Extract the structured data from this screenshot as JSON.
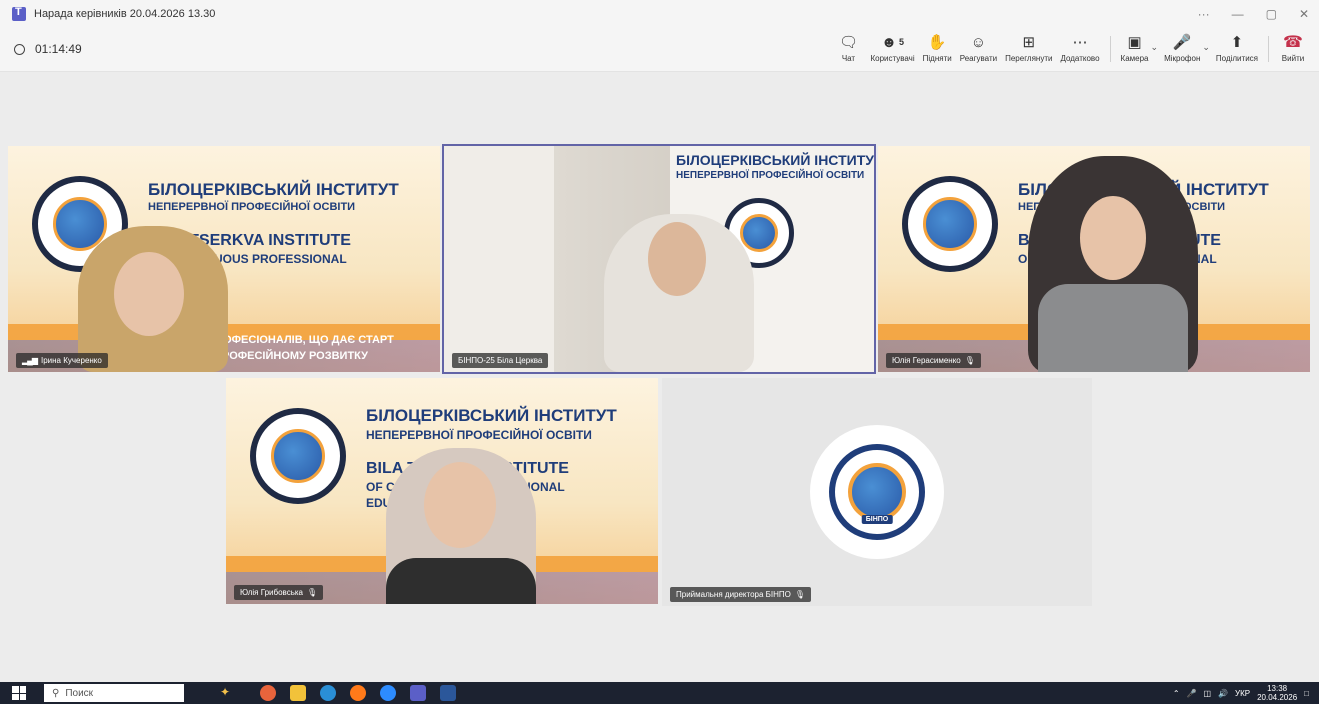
{
  "window": {
    "title": "Нарада керівників 20.04.2026 13.30",
    "controls": [
      "···",
      "—",
      "▢",
      "✕"
    ]
  },
  "meeting": {
    "timer": "01:14:49"
  },
  "toolbar": {
    "chat": "Чат",
    "people": "Користувачі",
    "people_count": "5",
    "raise": "Підняти",
    "react": "Реагувати",
    "view": "Переглянути",
    "more": "Додатково",
    "camera": "Камера",
    "mic": "Мікрофон",
    "share": "Поділитися",
    "leave": "Вийти"
  },
  "banner": {
    "line1": "БІЛОЦЕРКІВСЬКИЙ ІНСТИТУТ",
    "line2": "НЕПЕРЕРВНОЇ ПРОФЕСІЙНОЇ ОСВІТИ",
    "line3": "BILA TSERKVA INSTITUTE",
    "line4": "OF CONTINUOUS PROFESSIONAL",
    "line5": "EDUCATION",
    "line6": "ПРОФЕСІОНАЛІВ, ЩО ДАЄ СТАРТ",
    "line7": "І ПРОФЕСІЙНОМУ РОЗВИТКУ"
  },
  "participants": [
    {
      "name": "Ірина Кучеренко"
    },
    {
      "name": "БІНПО-25 Біла Церква"
    },
    {
      "name": "Юлія Герасименко"
    },
    {
      "name": "Юлія Грибовська"
    },
    {
      "name": "Приймальня директора БІНПО"
    }
  ],
  "avatar_label": "БІНПО",
  "taskbar": {
    "search_placeholder": "Поиск",
    "lang": "УКР",
    "time": "13:38",
    "date": "20.04.2026"
  },
  "colors": {
    "accent": "#6264a7",
    "leave": "#c4314b",
    "brand_blue": "#1f3d7a",
    "brand_orange": "#f3a23c"
  }
}
